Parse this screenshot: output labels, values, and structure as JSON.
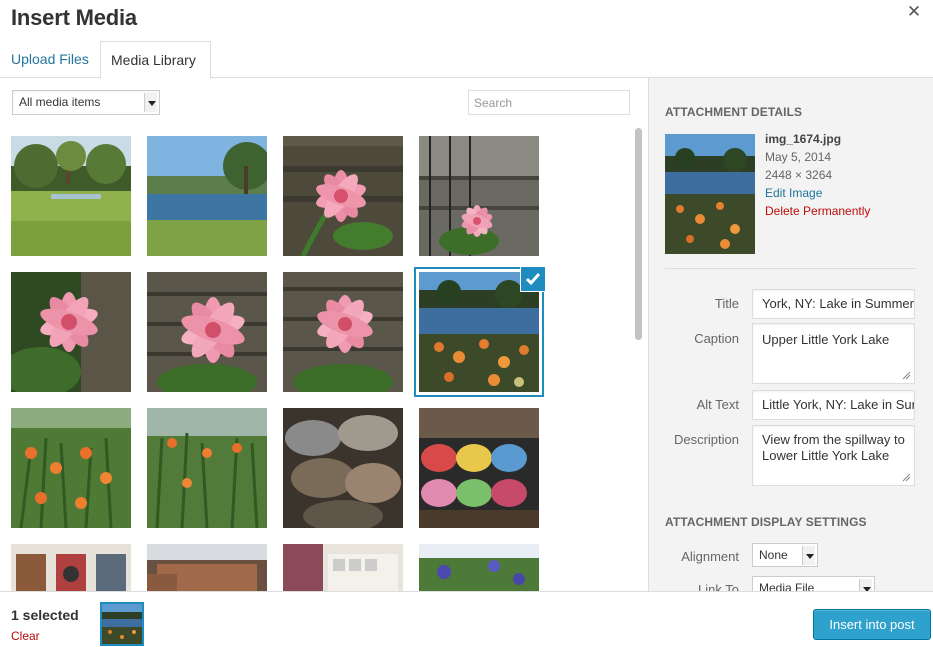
{
  "modal": {
    "title": "Insert Media"
  },
  "tabs": [
    {
      "label": "Upload Files",
      "active": false
    },
    {
      "label": "Media Library",
      "active": true
    }
  ],
  "toolbar": {
    "filter_selected": "All media items",
    "search_placeholder": "Search"
  },
  "library": {
    "items": [
      {
        "icon": "park-lawn-photo"
      },
      {
        "icon": "lake-shore-photo"
      },
      {
        "icon": "pink-lily-photo"
      },
      {
        "icon": "lily-by-railing-photo"
      },
      {
        "icon": "pink-lily-photo"
      },
      {
        "icon": "pink-lily-photo"
      },
      {
        "icon": "pink-lily-photo"
      },
      {
        "icon": "lake-orange-flowers-photo",
        "selected": true
      },
      {
        "icon": "orange-daylilies-photo"
      },
      {
        "icon": "daylilies-garden-photo"
      },
      {
        "icon": "yarn-skeins-photo"
      },
      {
        "icon": "yarn-shelves-photo"
      },
      {
        "icon": "shop-shelves-photo"
      },
      {
        "icon": "store-aisle-photo"
      },
      {
        "icon": "white-shelves-photo"
      },
      {
        "icon": "iris-flowers-photo"
      }
    ]
  },
  "details": {
    "heading": "Attachment Details",
    "filename": "img_1674.jpg",
    "date": "May 5, 2014",
    "dimensions": "2448 × 3264",
    "edit_label": "Edit Image",
    "delete_label": "Delete Permanently",
    "title_label": "Title",
    "title_value": "York, NY: Lake in Summer",
    "caption_label": "Caption",
    "caption_value": "Upper Little York Lake",
    "alt_label": "Alt Text",
    "alt_value": "Little York, NY: Lake in Sur",
    "description_label": "Description",
    "description_value": "View from the spillway to Lower Little York Lake"
  },
  "display_settings": {
    "heading": "Attachment Display Settings",
    "alignment_label": "Alignment",
    "alignment_value": "None",
    "link_label": "Link To",
    "link_value": "Media File"
  },
  "footer": {
    "selected_text": "1 selected",
    "clear_label": "Clear",
    "insert_label": "Insert into post"
  },
  "colors": {
    "accent": "#1e8cbe",
    "button": "#2ea2cc",
    "link": "#21759b",
    "danger": "#bc0b0b",
    "sidebar_bg": "#f3f3f3"
  }
}
